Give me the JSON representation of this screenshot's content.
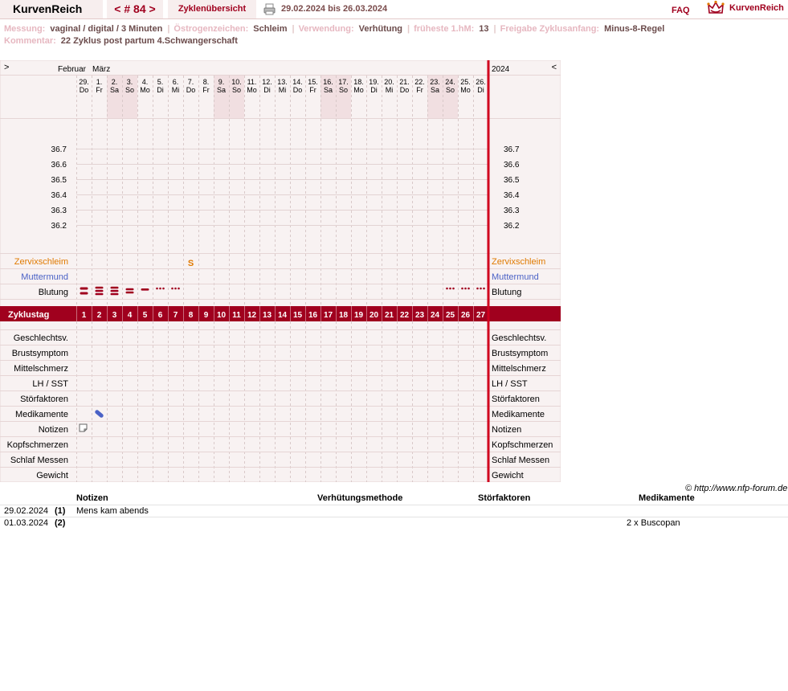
{
  "header": {
    "brand": "KurvenReich",
    "cycle_nav": "< # 84 >",
    "overview": "Zyklenübersicht",
    "date_range": "29.02.2024 bis 26.03.2024",
    "faq": "FAQ",
    "logo_text": "KurvenReich"
  },
  "info": {
    "messung_label": "Messung:",
    "messung_value": "vaginal / digital / 3 Minuten",
    "oestrogen_label": "Östrogenzeichen:",
    "oestrogen_value": "Schleim",
    "verwendung_label": "Verwendung:",
    "verwendung_value": "Verhütung",
    "fruehest_label": "früheste 1.hM:",
    "fruehest_value": "13",
    "freigabe_label": "Freigabe Zyklusanfang:",
    "freigabe_value": "Minus-8-Regel",
    "kommentar_label": "Kommentar:",
    "kommentar_value": "22 Zyklus post partum 4.Schwangerschaft"
  },
  "chart": {
    "nav_prev": ">",
    "nav_next": "<",
    "month_feb": "Februar",
    "month_mar": "März",
    "year": "2024",
    "dates": [
      "29.",
      "1.",
      "2.",
      "3.",
      "4.",
      "5.",
      "6.",
      "7.",
      "8.",
      "9.",
      "10.",
      "11.",
      "12.",
      "13.",
      "14.",
      "15.",
      "16.",
      "17.",
      "18.",
      "19.",
      "20.",
      "21.",
      "22.",
      "23.",
      "24.",
      "25.",
      "26."
    ],
    "weekdays": [
      "Do",
      "Fr",
      "Sa",
      "So",
      "Mo",
      "Di",
      "Mi",
      "Do",
      "Fr",
      "Sa",
      "So",
      "Mo",
      "Di",
      "Mi",
      "Do",
      "Fr",
      "Sa",
      "So",
      "Mo",
      "Di",
      "Mi",
      "Do",
      "Fr",
      "Sa",
      "So",
      "Mo",
      "Di"
    ],
    "weekend_indices": [
      2,
      3,
      9,
      10,
      16,
      17,
      23,
      24
    ],
    "temp_labels": [
      "36.7",
      "36.6",
      "36.5",
      "36.4",
      "36.3",
      "36.2"
    ],
    "zyklustag_label": "Zyklustag",
    "cycle_days": [
      "1",
      "2",
      "3",
      "4",
      "5",
      "6",
      "7",
      "8",
      "9",
      "10",
      "11",
      "12",
      "13",
      "14",
      "15",
      "16",
      "17",
      "18",
      "19",
      "20",
      "21",
      "22",
      "23",
      "24",
      "25",
      "26",
      "27"
    ],
    "row_labels_top": [
      "Zervixschleim",
      "Muttermund",
      "Blutung"
    ],
    "row_labels_bottom": [
      "Geschlechtsv.",
      "Brustsymptom",
      "Mittelschmerz",
      "LH / SST",
      "Störfaktoren",
      "Medikamente",
      "Notizen",
      "Kopfschmerzen",
      "Schlaf Messen",
      "Gewicht"
    ],
    "zervix_entries": [
      {
        "day": 8,
        "symbol": "S"
      }
    ],
    "blutung": [
      {
        "day": 1,
        "level": "heavy"
      },
      {
        "day": 2,
        "level": "heavy3"
      },
      {
        "day": 3,
        "level": "heavy3"
      },
      {
        "day": 4,
        "level": "medium"
      },
      {
        "day": 5,
        "level": "light"
      },
      {
        "day": 6,
        "level": "spotting"
      },
      {
        "day": 7,
        "level": "spotting"
      },
      {
        "day": 25,
        "level": "spotting"
      },
      {
        "day": 26,
        "level": "spotting"
      },
      {
        "day": 27,
        "level": "spotting"
      }
    ],
    "medikamente_days": [
      2
    ],
    "notizen_days": [
      1
    ],
    "colors": {
      "accent": "#a0001e",
      "zervix": "#e07a00",
      "muttermund": "#4a62c6",
      "grid_bg": "#f8f2f2",
      "weekend_bg": "#f1dfe1",
      "pill": "#4a62c6"
    }
  },
  "notes": {
    "headers": [
      "Notizen",
      "Verhütungsmethode",
      "Störfaktoren",
      "Medikamente"
    ],
    "rows": [
      {
        "date": "29.02.2024",
        "num": "(1)",
        "notiz": "Mens kam abends",
        "medikament": ""
      },
      {
        "date": "01.03.2024",
        "num": "(2)",
        "notiz": "",
        "medikament": "2 x Buscopan"
      }
    ]
  },
  "footer": {
    "copyright": "© http://www.nfp-forum.de"
  }
}
